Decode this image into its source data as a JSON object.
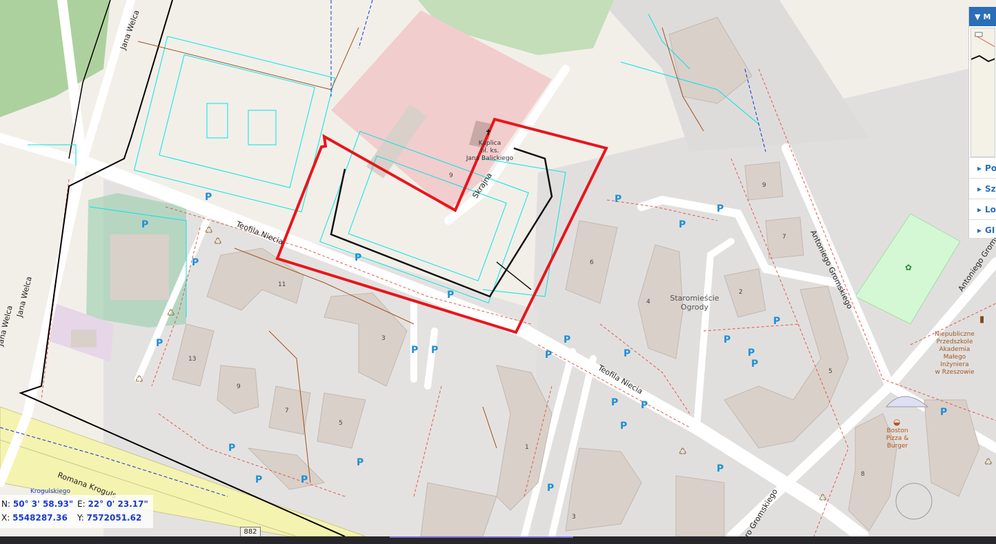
{
  "streets": {
    "teofila_niecia_1": "Teofila Niecia",
    "teofila_niecia_2": "Teofila Niecia",
    "skrajna": "Skrajna",
    "jana_welca_1": "Jana Welca",
    "jana_welca_2": "Jana Welca",
    "jana_welca_3": "Jana Welca",
    "antoniego_gromskiego_1": "Antoniego Gromskiego",
    "antoniego_gromskiego_2": "Antoniego Gromskiego",
    "antoniego_gromskiego_3": "ro Gromskiego",
    "romana_krogulskiego": "Romana Kroguls",
    "krogulskiego_stop": "Krogulskiego"
  },
  "places": {
    "kaplica": "Kaplica\nbł. ks.\nJana Balickiego",
    "staromiescie_ogrody": "Staromieście\nOgrody",
    "przedszkole": "Niepubliczne\nPrzedszkole\nAkademia\nMałego\nInżyniera\nw Rzeszowie",
    "boston_pizza": "Boston\nPizza &\nBurger"
  },
  "road_ref": "882",
  "house_numbers": [
    "9",
    "11",
    "3",
    "13",
    "9",
    "7",
    "5",
    "6",
    "4",
    "2",
    "9",
    "7",
    "5",
    "1",
    "3",
    "8"
  ],
  "coordinates": {
    "n_label": "N:",
    "n_value": "50° 3' 58.93\"",
    "e_label": "E:",
    "e_value": "22° 0' 23.17\"",
    "x_label": "X:",
    "x_value": "5548287.36",
    "y_label": "Y:",
    "y_value": "7572051.62"
  },
  "panel": {
    "header": "M",
    "items": [
      "Po",
      "Sz",
      "Lo",
      "GI"
    ]
  },
  "colors": {
    "highlight": "#e8151b",
    "utility_lines": "#00e5e5",
    "parcel_lines": "#e05a4a",
    "building": "#d9d0c9",
    "road": "#ffffff",
    "church_area": "#f2cdcd",
    "wood": "#add19e",
    "playground": "#c2e9c6",
    "trunk_road": "#f5f3b0"
  }
}
